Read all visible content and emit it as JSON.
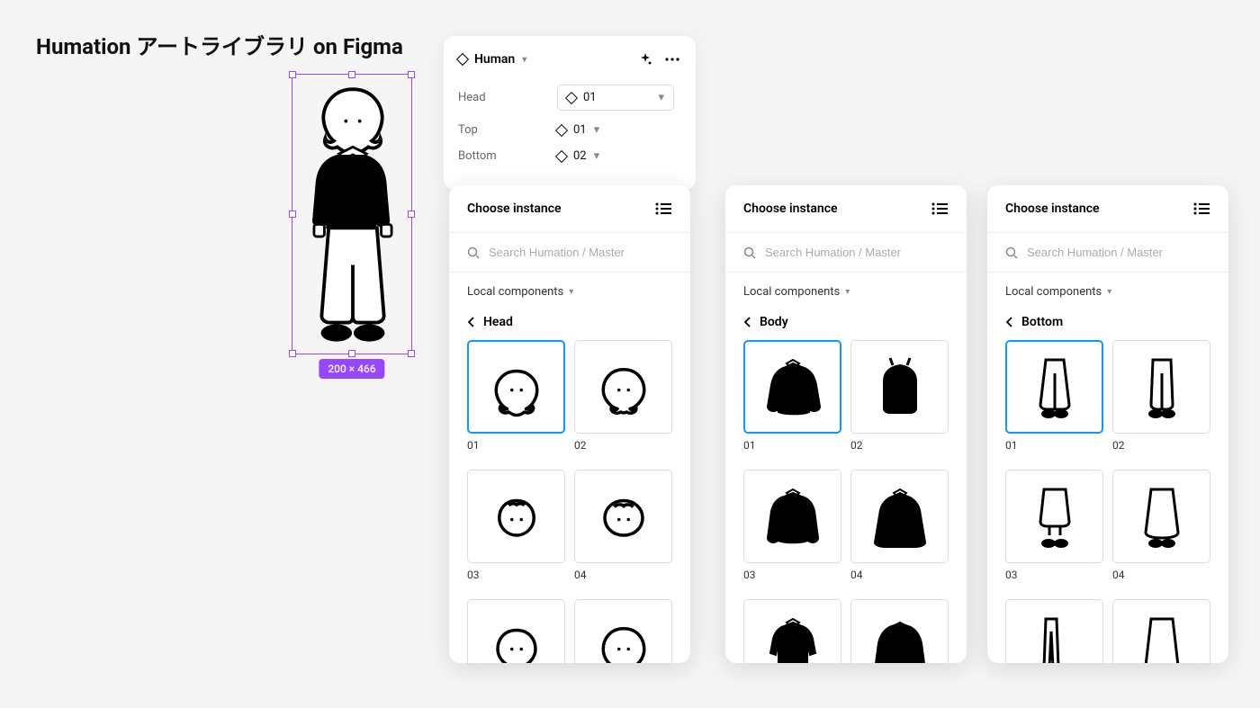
{
  "page_title": "Humation アートライブラリ on Figma",
  "selection": {
    "size_label": "200 × 466"
  },
  "props_panel": {
    "component_name": "Human",
    "rows": [
      {
        "label": "Head",
        "value": "01",
        "boxed": true
      },
      {
        "label": "Top",
        "value": "01",
        "boxed": false
      },
      {
        "label": "Bottom",
        "value": "02",
        "boxed": false
      }
    ]
  },
  "instance_panels": {
    "header_title": "Choose instance",
    "search_placeholder": "Search Humation / Master",
    "local_label": "Local components",
    "panels": [
      {
        "breadcrumb": "Head",
        "items": [
          {
            "label": "01",
            "selected": true
          },
          {
            "label": "02",
            "selected": false
          },
          {
            "label": "03",
            "selected": false
          },
          {
            "label": "04",
            "selected": false
          },
          {
            "label": "",
            "selected": false
          },
          {
            "label": "",
            "selected": false
          }
        ]
      },
      {
        "breadcrumb": "Body",
        "items": [
          {
            "label": "01",
            "selected": true
          },
          {
            "label": "02",
            "selected": false
          },
          {
            "label": "03",
            "selected": false
          },
          {
            "label": "04",
            "selected": false
          },
          {
            "label": "",
            "selected": false
          },
          {
            "label": "",
            "selected": false
          }
        ]
      },
      {
        "breadcrumb": "Bottom",
        "items": [
          {
            "label": "01",
            "selected": true
          },
          {
            "label": "02",
            "selected": false
          },
          {
            "label": "03",
            "selected": false
          },
          {
            "label": "04",
            "selected": false
          },
          {
            "label": "",
            "selected": false
          },
          {
            "label": "",
            "selected": false
          }
        ]
      }
    ]
  }
}
